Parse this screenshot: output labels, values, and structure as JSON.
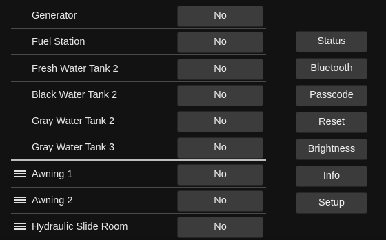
{
  "rows": [
    {
      "label": "Generator",
      "value": "No",
      "handle": false
    },
    {
      "label": "Fuel Station",
      "value": "No",
      "handle": false
    },
    {
      "label": "Fresh Water Tank 2",
      "value": "No",
      "handle": false
    },
    {
      "label": "Black Water Tank 2",
      "value": "No",
      "handle": false
    },
    {
      "label": "Gray Water Tank 2",
      "value": "No",
      "handle": false
    },
    {
      "label": "Gray Water Tank 3",
      "value": "No",
      "handle": false
    },
    {
      "label": "Awning 1",
      "value": "No",
      "handle": true
    },
    {
      "label": "Awning 2",
      "value": "No",
      "handle": true
    },
    {
      "label": "Hydraulic Slide Room",
      "value": "No",
      "handle": true
    }
  ],
  "side_menu": {
    "status": "Status",
    "bluetooth": "Bluetooth",
    "passcode": "Passcode",
    "reset": "Reset",
    "brightness": "Brightness",
    "info": "Info",
    "setup": "Setup"
  },
  "icons": {
    "drag_handle": "drag-handle-icon"
  },
  "colors": {
    "background": "#121212",
    "button": "#3c3c3c",
    "divider": "#4a4a4a",
    "section_divider": "#bdbdbd",
    "text": "#e6e6e6"
  }
}
